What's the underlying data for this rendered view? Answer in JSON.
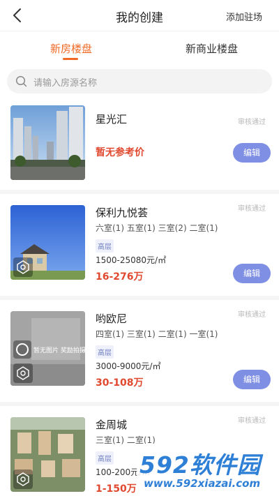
{
  "header": {
    "title": "我的创建",
    "add_label": "添加驻场"
  },
  "tabs": [
    {
      "label": "新房楼盘",
      "active": true
    },
    {
      "label": "新商业楼盘",
      "active": false
    }
  ],
  "search": {
    "placeholder": "请输入房源名称"
  },
  "colors": {
    "accent": "#f06a25",
    "price": "#e0482f",
    "edit_button": "#7f8fe3"
  },
  "listings": [
    {
      "name": "星光汇",
      "status": "审核通过",
      "price_note": "暂无参考价",
      "edit_label": "编辑"
    },
    {
      "name": "保利九悦荟",
      "status": "审核通过",
      "rooms": "六室(1) 五室(1) 三室(2) 二室(1)",
      "tag": "高层",
      "unit_price": "1500-25080元/㎡",
      "total_price": "16-276万",
      "edit_label": "编辑"
    },
    {
      "name": "哟欧尼",
      "status": "审核通过",
      "rooms": "四室(1) 三室(1) 二室(1) 一室(1)",
      "tag": "高层",
      "unit_price": "3000-9000元/㎡",
      "total_price": "30-108万",
      "edit_label": "编辑",
      "thumb_text": "暂无图片 奖励拍摄中..."
    },
    {
      "name": "金周城",
      "status": "审核通过",
      "rooms": "三室(1) 二室(1)",
      "tag": "高层",
      "unit_price": "100-200元/㎡",
      "total_price": "1-150万"
    }
  ],
  "watermark": {
    "text": "592软件园",
    "url": "www.592xiazai.com"
  }
}
